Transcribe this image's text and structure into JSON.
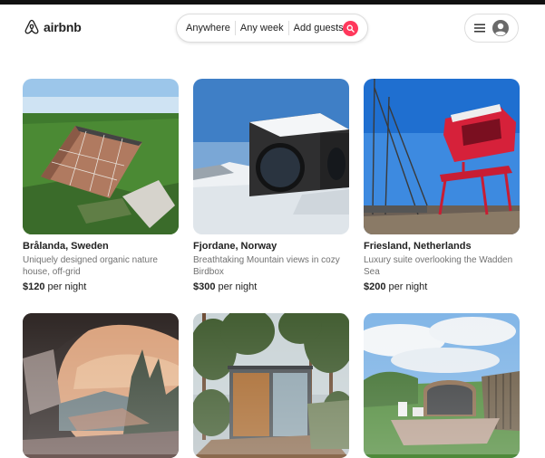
{
  "brand": {
    "name": "airbnb",
    "color": "#ff385c"
  },
  "search": {
    "where": "Anywhere",
    "when": "Any week",
    "guests": "Add guests",
    "icon": "search-icon"
  },
  "user_menu": {
    "icons": [
      "hamburger-menu-icon",
      "avatar-icon"
    ]
  },
  "listings": [
    {
      "location": "Brålanda, Sweden",
      "description": "Uniquely designed organic nature house, off-grid",
      "price": "$120",
      "price_suffix": " per night"
    },
    {
      "location": "Fjordane, Norway",
      "description": "Breathtaking Mountain views in cozy Birdbox",
      "price": "$300",
      "price_suffix": " per night"
    },
    {
      "location": "Friesland, Netherlands",
      "description": "Luxury suite overlooking the Wadden Sea",
      "price": "$200",
      "price_suffix": " per night"
    },
    {
      "location": "",
      "description": "",
      "price": "",
      "price_suffix": ""
    },
    {
      "location": "",
      "description": "",
      "price": "",
      "price_suffix": ""
    },
    {
      "location": "",
      "description": "",
      "price": "",
      "price_suffix": ""
    }
  ]
}
